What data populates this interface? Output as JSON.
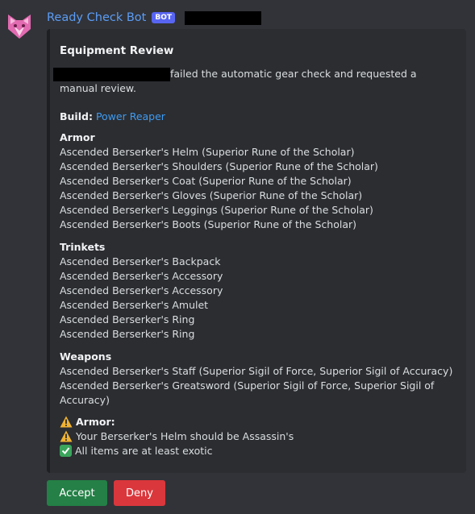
{
  "message": {
    "author": "Ready Check Bot",
    "bot_tag": "BOT",
    "avatar_icon": "pink-cat-icon",
    "colors": {
      "username": "#5b9cf5",
      "bot_tag": "#5865f2",
      "link": "#3f9bf2",
      "accept": "#248046",
      "deny": "#da373c"
    }
  },
  "embed": {
    "title": "Equipment Review",
    "description": "failed the automatic gear check and requested a manual review.",
    "build_label": "Build:",
    "build_value": "Power Reaper",
    "armor": {
      "heading": "Armor",
      "items": [
        "Ascended Berserker's Helm (Superior Rune of the Scholar)",
        "Ascended Berserker's Shoulders (Superior Rune of the Scholar)",
        "Ascended Berserker's Coat (Superior Rune of the Scholar)",
        "Ascended Berserker's Gloves (Superior Rune of the Scholar)",
        "Ascended Berserker's Leggings (Superior Rune of the Scholar)",
        "Ascended Berserker's Boots (Superior Rune of the Scholar)"
      ]
    },
    "trinkets": {
      "heading": "Trinkets",
      "items": [
        "Ascended Berserker's Backpack",
        "Ascended Berserker's Accessory",
        "Ascended Berserker's Accessory",
        "Ascended Berserker's Amulet",
        "Ascended Berserker's Ring",
        "Ascended Berserker's Ring"
      ]
    },
    "weapons": {
      "heading": "Weapons",
      "items": [
        "Ascended Berserker's Staff (Superior Sigil of Force, Superior Sigil of Accuracy)",
        "Ascended Berserker's Greatsword (Superior Sigil of Force, Superior Sigil of Accuracy)"
      ]
    },
    "check": {
      "heading": "Armor:",
      "warning": "Your Berserker's Helm should be Assassin's",
      "ok": "All items are at least exotic"
    }
  },
  "buttons": {
    "accept": "Accept",
    "deny": "Deny"
  }
}
